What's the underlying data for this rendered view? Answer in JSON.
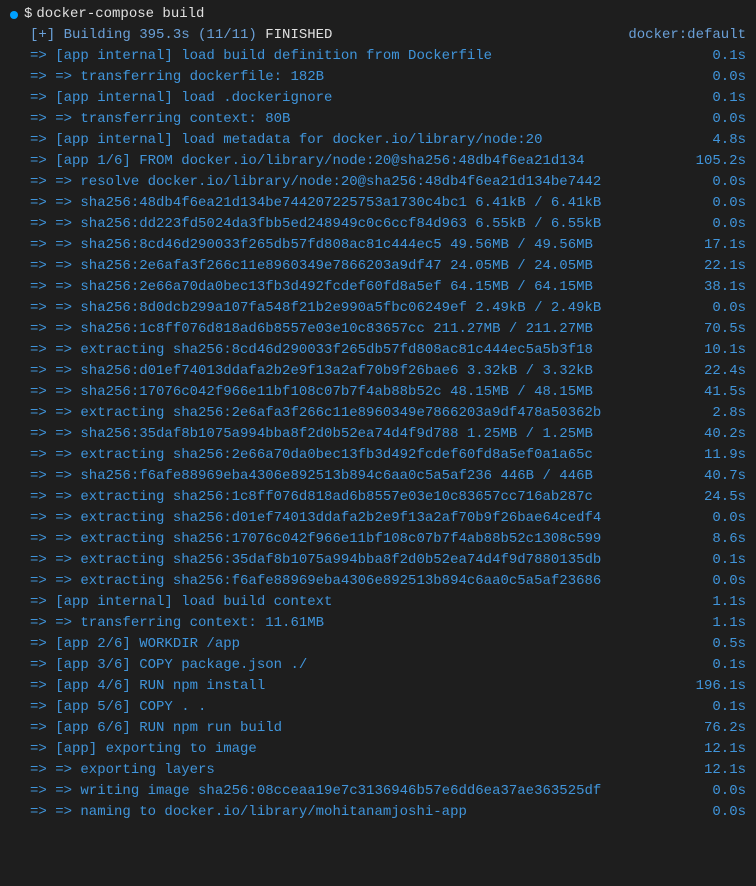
{
  "prompt": {
    "dollar": "$",
    "command": "docker-compose build"
  },
  "summary": {
    "left": "[+] Building 395.3s (11/11)",
    "finished": " FINISHED",
    "right": "docker:default"
  },
  "steps": [
    {
      "text": "=> [app internal] load build definition from Dockerfile",
      "time": "0.1s"
    },
    {
      "text": "=> => transferring dockerfile: 182B",
      "time": "0.0s"
    },
    {
      "text": "=> [app internal] load .dockerignore",
      "time": "0.1s"
    },
    {
      "text": "=> => transferring context: 80B",
      "time": "0.0s"
    },
    {
      "text": "=> [app internal] load metadata for docker.io/library/node:20",
      "time": "4.8s"
    },
    {
      "text": "=> [app 1/6] FROM docker.io/library/node:20@sha256:48db4f6ea21d134",
      "time": "105.2s"
    },
    {
      "text": "=> => resolve docker.io/library/node:20@sha256:48db4f6ea21d134be7442",
      "time": "0.0s"
    },
    {
      "text": "=> => sha256:48db4f6ea21d134be744207225753a1730c4bc1 6.41kB / 6.41kB",
      "time": "0.0s"
    },
    {
      "text": "=> => sha256:dd223fd5024da3fbb5ed248949c0c6ccf84d963 6.55kB / 6.55kB",
      "time": "0.0s"
    },
    {
      "text": "=> => sha256:8cd46d290033f265db57fd808ac81c444ec5 49.56MB / 49.56MB",
      "time": "17.1s"
    },
    {
      "text": "=> => sha256:2e6afa3f266c11e8960349e7866203a9df47 24.05MB / 24.05MB",
      "time": "22.1s"
    },
    {
      "text": "=> => sha256:2e66a70da0bec13fb3d492fcdef60fd8a5ef 64.15MB / 64.15MB",
      "time": "38.1s"
    },
    {
      "text": "=> => sha256:8d0dcb299a107fa548f21b2e990a5fbc06249ef 2.49kB / 2.49kB",
      "time": "0.0s"
    },
    {
      "text": "=> => sha256:1c8ff076d818ad6b8557e03e10c83657cc 211.27MB / 211.27MB",
      "time": "70.5s"
    },
    {
      "text": "=> => extracting sha256:8cd46d290033f265db57fd808ac81c444ec5a5b3f18",
      "time": "10.1s"
    },
    {
      "text": "=> => sha256:d01ef74013ddafa2b2e9f13a2af70b9f26bae6 3.32kB / 3.32kB",
      "time": "22.4s"
    },
    {
      "text": "=> => sha256:17076c042f966e11bf108c07b7f4ab88b52c 48.15MB / 48.15MB",
      "time": "41.5s"
    },
    {
      "text": "=> => extracting sha256:2e6afa3f266c11e8960349e7866203a9df478a50362b",
      "time": "2.8s"
    },
    {
      "text": "=> => sha256:35daf8b1075a994bba8f2d0b52ea74d4f9d788 1.25MB / 1.25MB",
      "time": "40.2s"
    },
    {
      "text": "=> => extracting sha256:2e66a70da0bec13fb3d492fcdef60fd8a5ef0a1a65c",
      "time": "11.9s"
    },
    {
      "text": "=> => sha256:f6afe88969eba4306e892513b894c6aa0c5a5af236 446B / 446B",
      "time": "40.7s"
    },
    {
      "text": "=> => extracting sha256:1c8ff076d818ad6b8557e03e10c83657cc716ab287c",
      "time": "24.5s"
    },
    {
      "text": "=> => extracting sha256:d01ef74013ddafa2b2e9f13a2af70b9f26bae64cedf4",
      "time": "0.0s"
    },
    {
      "text": "=> => extracting sha256:17076c042f966e11bf108c07b7f4ab88b52c1308c599",
      "time": "8.6s"
    },
    {
      "text": "=> => extracting sha256:35daf8b1075a994bba8f2d0b52ea74d4f9d7880135db",
      "time": "0.1s"
    },
    {
      "text": "=> => extracting sha256:f6afe88969eba4306e892513b894c6aa0c5a5af23686",
      "time": "0.0s"
    },
    {
      "text": "=> [app internal] load build context",
      "time": "1.1s"
    },
    {
      "text": "=> => transferring context: 11.61MB",
      "time": "1.1s"
    },
    {
      "text": "=> [app 2/6] WORKDIR /app",
      "time": "0.5s"
    },
    {
      "text": "=> [app 3/6] COPY package.json ./",
      "time": "0.1s"
    },
    {
      "text": "=> [app 4/6] RUN npm install",
      "time": "196.1s"
    },
    {
      "text": "=> [app 5/6] COPY . .",
      "time": "0.1s"
    },
    {
      "text": "=> [app 6/6] RUN npm run build",
      "time": "76.2s"
    },
    {
      "text": "=> [app] exporting to image",
      "time": "12.1s"
    },
    {
      "text": "=> => exporting layers",
      "time": "12.1s"
    },
    {
      "text": "=> => writing image sha256:08cceaa19e7c3136946b57e6dd6ea37ae363525df",
      "time": "0.0s"
    },
    {
      "text": "=> => naming to docker.io/library/mohitanamjoshi-app",
      "time": "0.0s"
    }
  ]
}
